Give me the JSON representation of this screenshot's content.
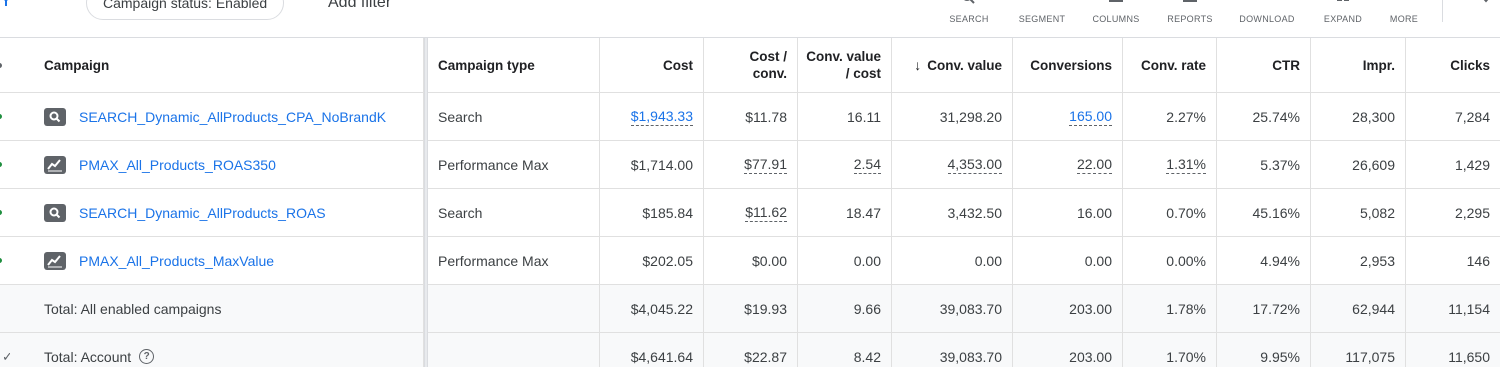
{
  "toolbar": {
    "status_chip": "Campaign status: Enabled",
    "add_filter": "Add filter",
    "tools": [
      {
        "label": "SEARCH",
        "icon": "search-icon"
      },
      {
        "label": "SEGMENT",
        "icon": "segment-icon"
      },
      {
        "label": "COLUMNS",
        "icon": "columns-icon"
      },
      {
        "label": "REPORTS",
        "icon": "reports-icon"
      },
      {
        "label": "DOWNLOAD",
        "icon": "download-icon"
      },
      {
        "label": "EXPAND",
        "icon": "expand-icon"
      },
      {
        "label": "MORE",
        "icon": "more-icon"
      }
    ]
  },
  "table": {
    "headers": {
      "campaign": "Campaign",
      "campaign_type": "Campaign type",
      "cost": "Cost",
      "cost_per_conv": "Cost / conv.",
      "conv_value_per_cost": "Conv. value / cost",
      "conv_value": "Conv. value",
      "conversions": "Conversions",
      "conv_rate": "Conv. rate",
      "ctr": "CTR",
      "impr": "Impr.",
      "clicks": "Clicks"
    },
    "rows": [
      {
        "campaign": "SEARCH_Dynamic_AllProducts_CPA_NoBrandK",
        "icon": "search-campaign-icon",
        "type": "Search",
        "cost": "$1,943.33",
        "cost_per_conv": "$11.78",
        "conv_value_per_cost": "16.11",
        "conv_value": "31,298.20",
        "conversions": "165.00",
        "conv_rate": "2.27%",
        "ctr": "25.74%",
        "impr": "28,300",
        "clicks": "7,284"
      },
      {
        "campaign": "PMAX_All_Products_ROAS350",
        "icon": "performance-max-icon",
        "type": "Performance Max",
        "cost": "$1,714.00",
        "cost_per_conv": "$77.91",
        "conv_value_per_cost": "2.54",
        "conv_value": "4,353.00",
        "conversions": "22.00",
        "conv_rate": "1.31%",
        "ctr": "5.37%",
        "impr": "26,609",
        "clicks": "1,429"
      },
      {
        "campaign": "SEARCH_Dynamic_AllProducts_ROAS",
        "icon": "search-campaign-icon",
        "type": "Search",
        "cost": "$185.84",
        "cost_per_conv": "$11.62",
        "conv_value_per_cost": "18.47",
        "conv_value": "3,432.50",
        "conversions": "16.00",
        "conv_rate": "0.70%",
        "ctr": "45.16%",
        "impr": "5,082",
        "clicks": "2,295"
      },
      {
        "campaign": "PMAX_All_Products_MaxValue",
        "icon": "performance-max-icon",
        "type": "Performance Max",
        "cost": "$202.05",
        "cost_per_conv": "$0.00",
        "conv_value_per_cost": "0.00",
        "conv_value": "0.00",
        "conversions": "0.00",
        "conv_rate": "0.00%",
        "ctr": "4.94%",
        "impr": "2,953",
        "clicks": "146"
      }
    ],
    "totals": [
      {
        "label": "Total: All enabled campaigns",
        "cost": "$4,045.22",
        "cost_per_conv": "$19.93",
        "conv_value_per_cost": "9.66",
        "conv_value": "39,083.70",
        "conversions": "203.00",
        "conv_rate": "1.78%",
        "ctr": "17.72%",
        "impr": "62,944",
        "clicks": "11,154"
      },
      {
        "label": "Total: Account",
        "cost": "$4,641.64",
        "cost_per_conv": "$22.87",
        "conv_value_per_cost": "8.42",
        "conv_value": "39,083.70",
        "conversions": "203.00",
        "conv_rate": "1.70%",
        "ctr": "9.95%",
        "impr": "117,075",
        "clicks": "11,650"
      }
    ],
    "status_color": "#1e8e3e",
    "link_color": "#1a73e8"
  }
}
